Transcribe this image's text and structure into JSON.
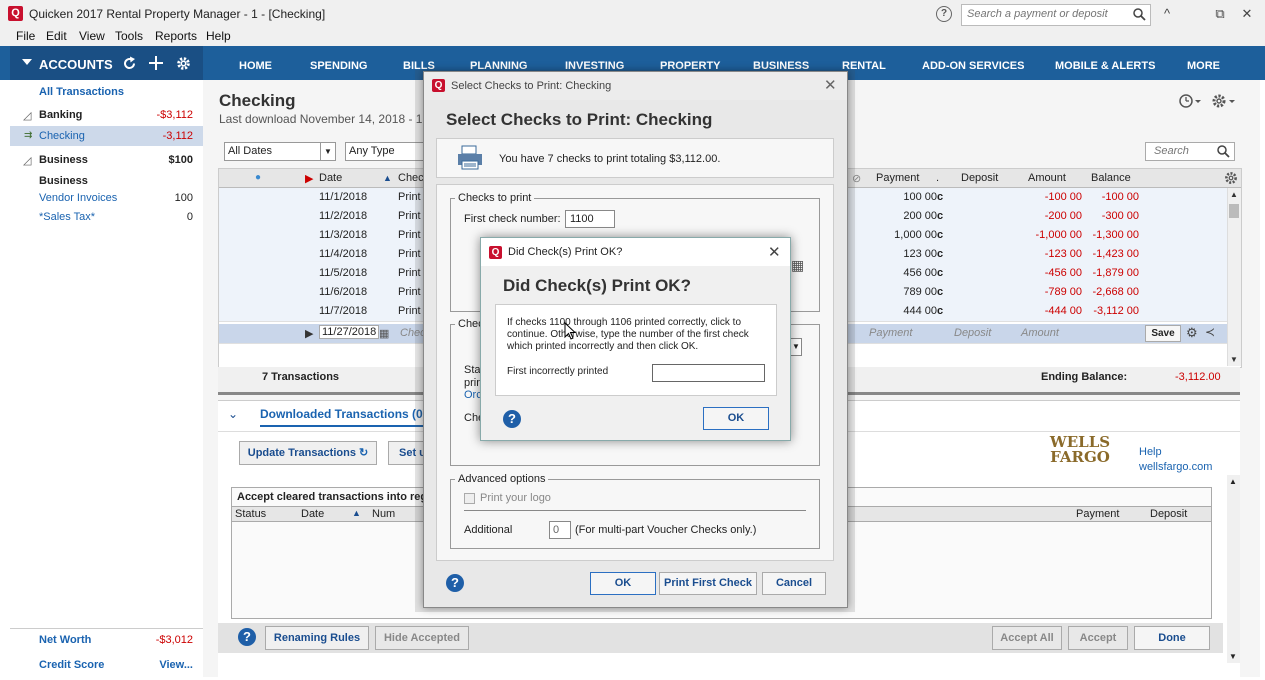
{
  "window": {
    "title": "Quicken 2017 Rental Property Manager - 1 - [Checking]",
    "app_icon": "Q",
    "search_placeholder": "Search a payment or deposit",
    "help_icon": "?",
    "controls": [
      "^",
      "⧉",
      "✕"
    ]
  },
  "menu": [
    "File",
    "Edit",
    "View",
    "Tools",
    "Reports",
    "Help"
  ],
  "nav": {
    "accounts_label": "ACCOUNTS",
    "tabs": [
      "HOME",
      "SPENDING",
      "BILLS",
      "PLANNING",
      "INVESTING",
      "PROPERTY",
      "BUSINESS",
      "RENTAL",
      "ADD-ON SERVICES",
      "MOBILE & ALERTS",
      "MORE"
    ]
  },
  "sidebar": {
    "all_transactions": "All Transactions",
    "banking_label": "Banking",
    "banking_total": "-$3,112",
    "checking_label": "Checking",
    "checking_value": "-3,112",
    "business_group": "Business",
    "business_total": "$100",
    "business_sub": "Business",
    "vendor_label": "Vendor Invoices",
    "vendor_value": "100",
    "salestax_label": "*Sales Tax*",
    "salestax_value": "0",
    "net_worth_label": "Net Worth",
    "net_worth_value": "-$3,012",
    "credit_score_label": "Credit Score",
    "credit_score_value": "View..."
  },
  "main": {
    "title": "Checking",
    "subtitle": "Last download November 14, 2018 - 1:4",
    "filter_dates": "All Dates",
    "filter_type": "Any Type",
    "search_placeholder": "Search",
    "columns": {
      "date": "Date",
      "check": "Check",
      "payment": "Payment",
      "clr": ".",
      "deposit": "Deposit",
      "amount": "Amount",
      "balance": "Balance"
    },
    "rows": [
      {
        "date": "11/1/2018",
        "check": "Print",
        "payment": "100 00",
        "clr": "c",
        "amount": "-100 00",
        "balance": "-100 00"
      },
      {
        "date": "11/2/2018",
        "check": "Print",
        "payment": "200 00",
        "clr": "c",
        "amount": "-200 00",
        "balance": "-300 00"
      },
      {
        "date": "11/3/2018",
        "check": "Print",
        "payment": "1,000 00",
        "clr": "c",
        "amount": "-1,000 00",
        "balance": "-1,300 00"
      },
      {
        "date": "11/4/2018",
        "check": "Print",
        "payment": "123 00",
        "clr": "c",
        "amount": "-123 00",
        "balance": "-1,423 00"
      },
      {
        "date": "11/5/2018",
        "check": "Print",
        "payment": "456 00",
        "clr": "c",
        "amount": "-456 00",
        "balance": "-1,879 00"
      },
      {
        "date": "11/6/2018",
        "check": "Print",
        "payment": "789 00",
        "clr": "c",
        "amount": "-789 00",
        "balance": "-2,668 00"
      },
      {
        "date": "11/7/2018",
        "check": "Print",
        "payment": "444 00",
        "clr": "c",
        "amount": "-444 00",
        "balance": "-3,112 00"
      }
    ],
    "entry_row": {
      "date": "11/27/2018",
      "check": "Chec",
      "payment": "Payment",
      "deposit": "Deposit",
      "amount": "Amount",
      "save": "Save"
    },
    "transactions_count": "7 Transactions",
    "ending_balance_label": "Ending Balance:",
    "ending_balance_value": "-3,112.00"
  },
  "downloaded": {
    "header": "Downloaded Transactions (0)",
    "update_button": "Update Transactions",
    "setup_button": "Set u",
    "bank_logo_line1": "WELLS",
    "bank_logo_line2": "FARGO",
    "help_link": "Help",
    "site_link": "wellsfargo.com",
    "accept_label": "Accept cleared transactions into regist",
    "cols": {
      "status": "Status",
      "date": "Date",
      "num": "Num",
      "payment": "Payment",
      "deposit": "Deposit"
    },
    "renaming_rules": "Renaming Rules",
    "hide_accepted": "Hide Accepted",
    "accept_all": "Accept All",
    "accept": "Accept",
    "done": "Done"
  },
  "print_dialog": {
    "window_title": "Select Checks to Print: Checking",
    "heading": "Select Checks to Print: Checking",
    "info": "You have 7 checks to print totaling $3,112.00.",
    "checks_to_print_legend": "Checks to print",
    "first_check_label": "First check number:",
    "first_check_value": "1100",
    "check_style_legend": "Chec",
    "style_label_partial": "Sta",
    "print_label_partial": "prin",
    "order_link_partial": "Orc",
    "check_label_partial": "Che",
    "advanced_legend": "Advanced options",
    "print_logo": "Print your logo",
    "additional_label": "Additional",
    "additional_value": "0",
    "additional_note": "(For multi-part Voucher Checks only.)",
    "ok": "OK",
    "print_first": "Print First Check",
    "cancel": "Cancel"
  },
  "confirm_dialog": {
    "window_title": "Did Check(s) Print OK?",
    "heading": "Did Check(s) Print OK?",
    "message": "If checks 1100 through 1106 printed correctly, click to continue. Otherwise, type the number of the first check which printed incorrectly and then click OK.",
    "first_incorrect_label": "First incorrectly printed",
    "first_incorrect_value": "",
    "ok": "OK"
  },
  "colors": {
    "nav_blue": "#1d5f9b",
    "accent_red": "#c8102e",
    "link_blue": "#1a63b0",
    "negative_red": "#cc0000"
  }
}
